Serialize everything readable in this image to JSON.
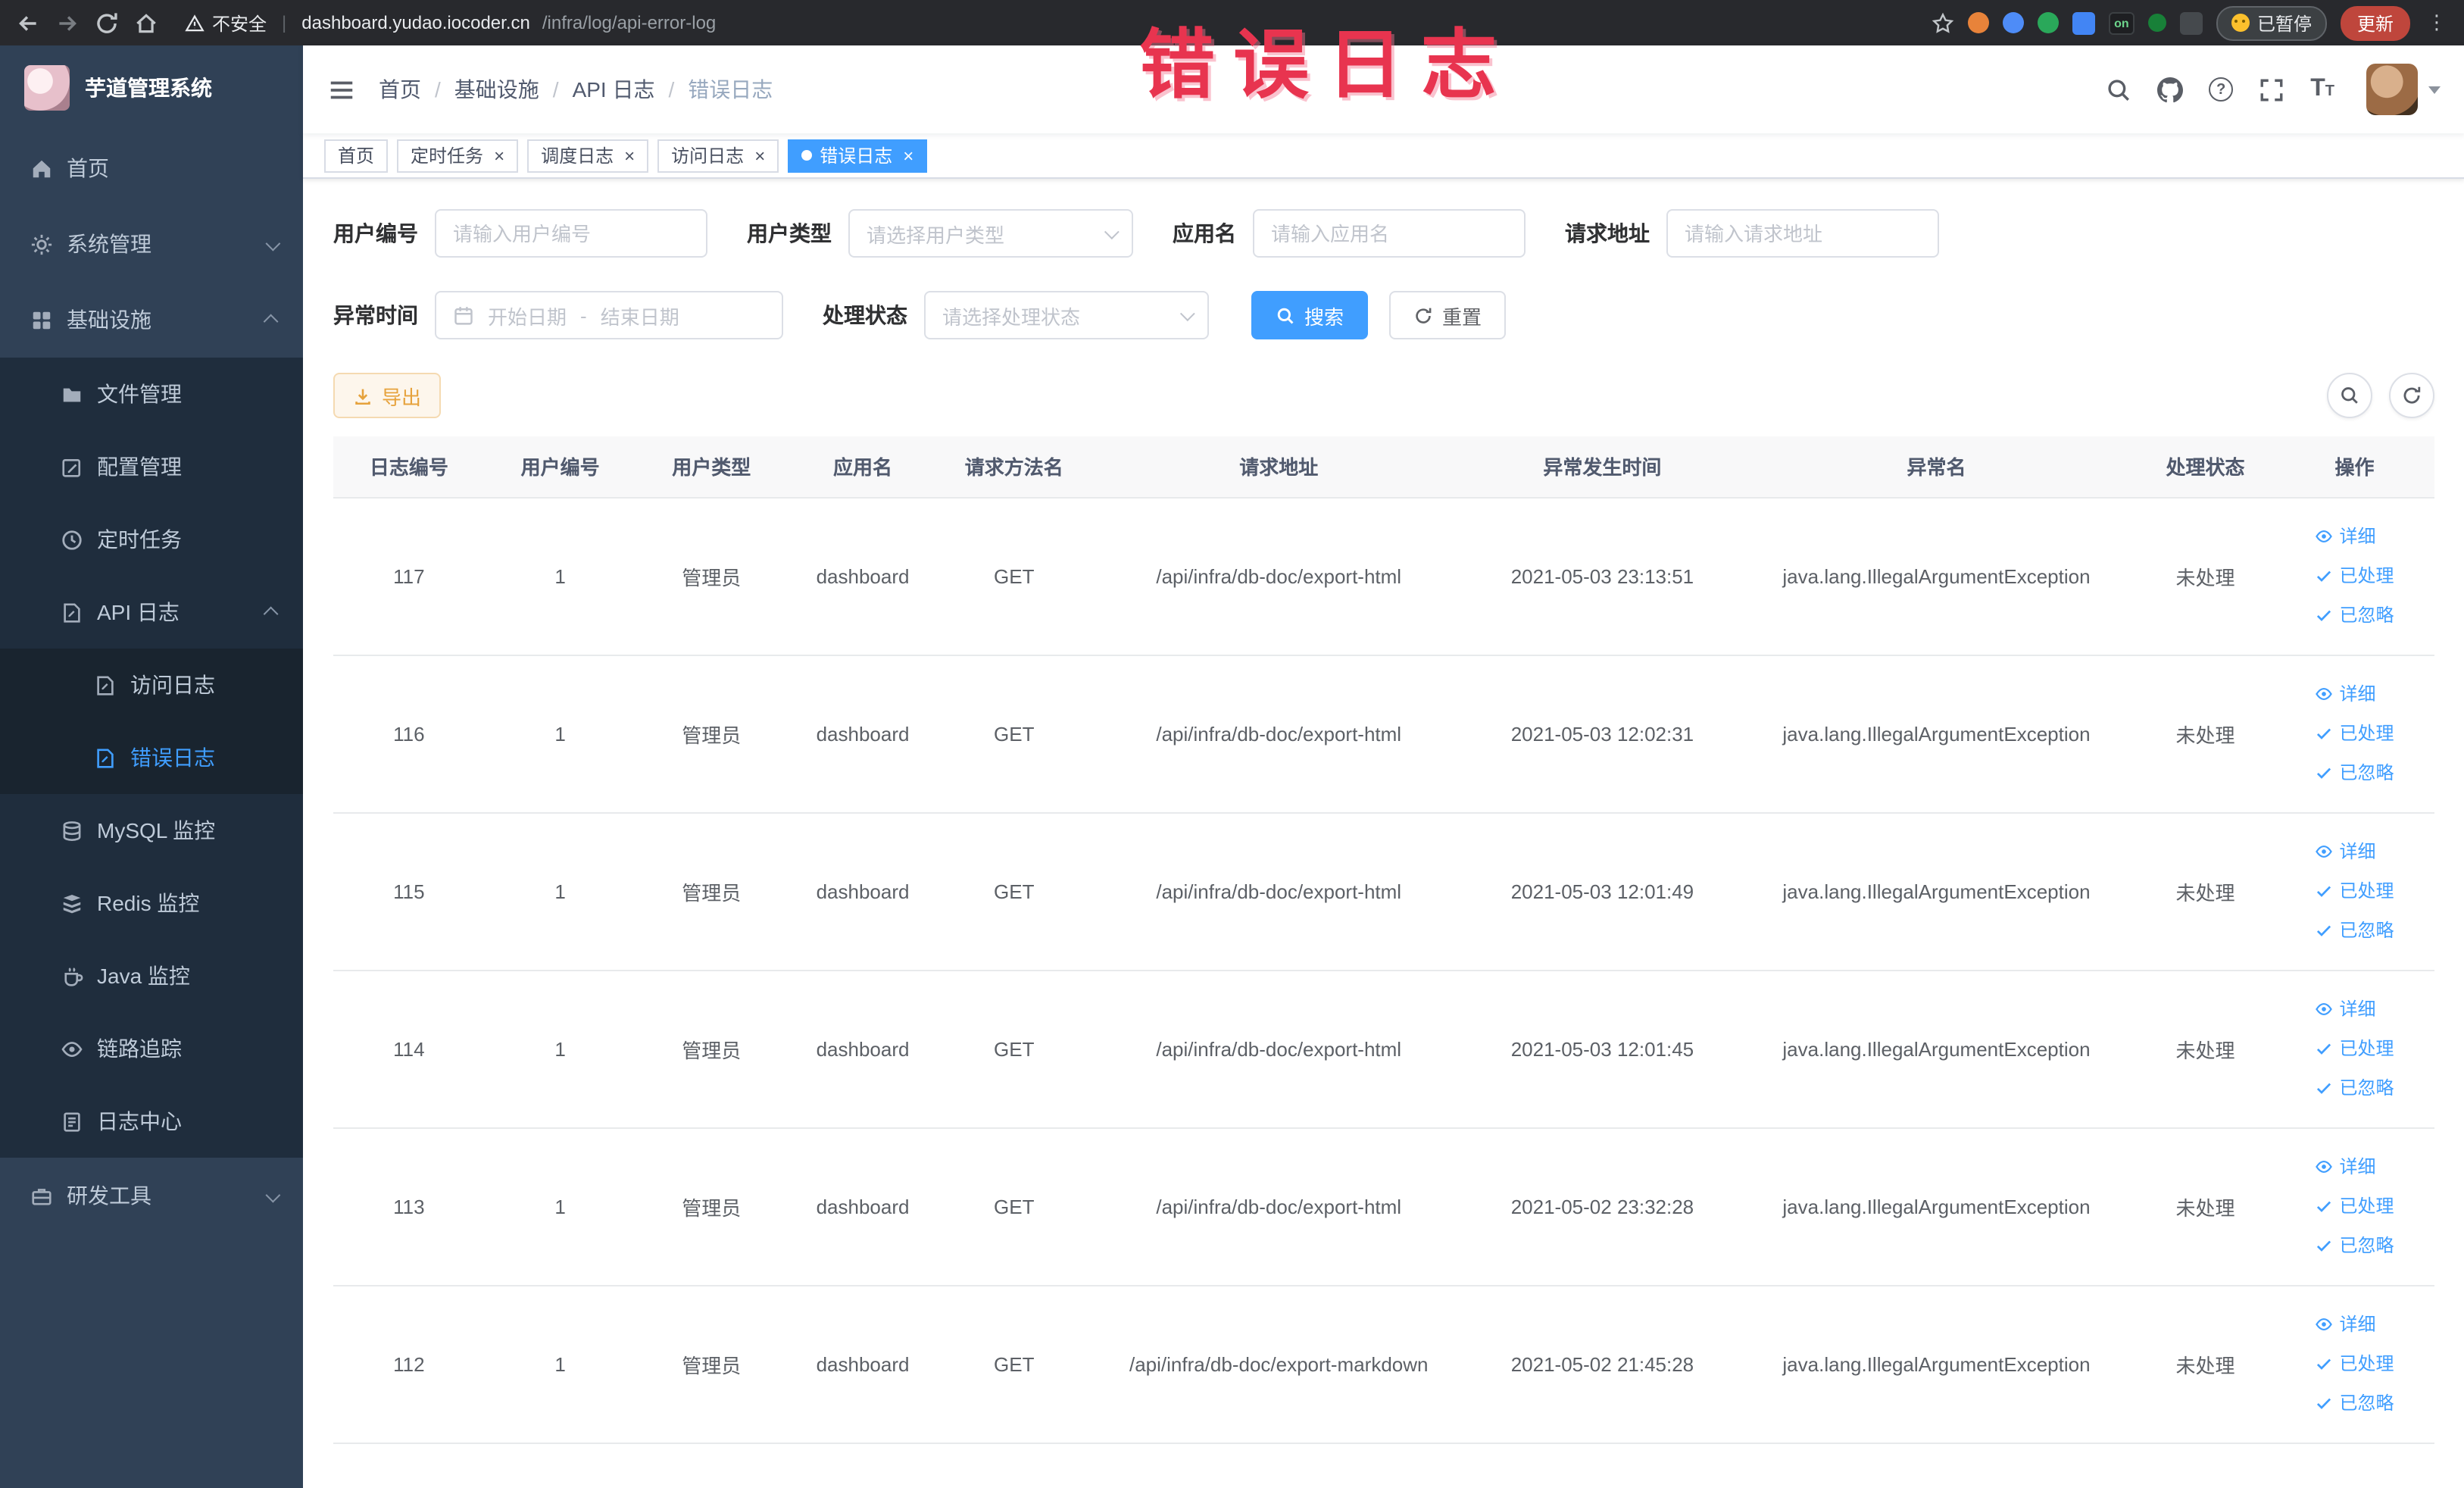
{
  "browser": {
    "security_label": "不安全",
    "url_host": "dashboard.yudao.iocoder.cn",
    "url_path": "/infra/log/api-error-log",
    "extension_badge": "on",
    "paused_label": "已暂停",
    "update_label": "更新"
  },
  "annotation": {
    "text": "错误日志"
  },
  "sidebar": {
    "logo_title": "芋道管理系统",
    "items": [
      {
        "id": "home",
        "label": "首页",
        "icon": "home-icon",
        "level": 1
      },
      {
        "id": "system",
        "label": "系统管理",
        "icon": "gear-icon",
        "level": 1,
        "arrow": "down"
      },
      {
        "id": "infra",
        "label": "基础设施",
        "icon": "grid-icon",
        "level": 1,
        "arrow": "up"
      },
      {
        "id": "file",
        "label": "文件管理",
        "icon": "folder-icon",
        "level": 2
      },
      {
        "id": "config",
        "label": "配置管理",
        "icon": "edit-square-icon",
        "level": 2
      },
      {
        "id": "job",
        "label": "定时任务",
        "icon": "clock-icon",
        "level": 2
      },
      {
        "id": "api-log",
        "label": "API 日志",
        "icon": "doc-edit-icon",
        "level": 2,
        "arrow": "up"
      },
      {
        "id": "access-log",
        "label": "访问日志",
        "icon": "doc-edit-icon",
        "level": 3
      },
      {
        "id": "error-log",
        "label": "错误日志",
        "icon": "doc-edit-icon",
        "level": 3,
        "active": true
      },
      {
        "id": "mysql",
        "label": "MySQL 监控",
        "icon": "database-icon",
        "level": 2
      },
      {
        "id": "redis",
        "label": "Redis 监控",
        "icon": "layers-icon",
        "level": 2
      },
      {
        "id": "java",
        "label": "Java 监控",
        "icon": "coffee-icon",
        "level": 2
      },
      {
        "id": "trace",
        "label": "链路追踪",
        "icon": "eye-icon",
        "level": 2
      },
      {
        "id": "log-center",
        "label": "日志中心",
        "icon": "doc-lines-icon",
        "level": 2
      },
      {
        "id": "dev-tools",
        "label": "研发工具",
        "icon": "briefcase-icon",
        "level": 1,
        "arrow": "down"
      }
    ]
  },
  "breadcrumb": {
    "items": [
      "首页",
      "基础设施",
      "API 日志",
      "错误日志"
    ]
  },
  "tabs": [
    {
      "id": "home",
      "label": "首页",
      "closable": false,
      "active": false
    },
    {
      "id": "job",
      "label": "定时任务",
      "closable": true,
      "active": false
    },
    {
      "id": "job-log",
      "label": "调度日志",
      "closable": true,
      "active": false
    },
    {
      "id": "access-log",
      "label": "访问日志",
      "closable": true,
      "active": false
    },
    {
      "id": "error-log",
      "label": "错误日志",
      "closable": true,
      "active": true
    }
  ],
  "filters": {
    "user_id": {
      "label": "用户编号",
      "placeholder": "请输入用户编号"
    },
    "user_type": {
      "label": "用户类型",
      "placeholder": "请选择用户类型"
    },
    "app_name": {
      "label": "应用名",
      "placeholder": "请输入应用名"
    },
    "request_url": {
      "label": "请求地址",
      "placeholder": "请输入请求地址"
    },
    "exception_time": {
      "label": "异常时间",
      "start_placeholder": "开始日期",
      "separator": "-",
      "end_placeholder": "结束日期"
    },
    "process_status": {
      "label": "处理状态",
      "placeholder": "请选择处理状态"
    },
    "search_label": "搜索",
    "reset_label": "重置"
  },
  "toolbar": {
    "export_label": "导出"
  },
  "table": {
    "columns": [
      "日志编号",
      "用户编号",
      "用户类型",
      "应用名",
      "请求方法名",
      "请求地址",
      "异常发生时间",
      "异常名",
      "处理状态",
      "操作"
    ],
    "actions": {
      "detail": "详细",
      "processed": "已处理",
      "ignored": "已忽略"
    },
    "rows": [
      {
        "log_id": "117",
        "user_id": "1",
        "user_type": "管理员",
        "app_name": "dashboard",
        "method": "GET",
        "url": "/api/infra/db-doc/export-html",
        "time": "2021-05-03 23:13:51",
        "exception": "java.lang.IllegalArgumentException",
        "status": "未处理"
      },
      {
        "log_id": "116",
        "user_id": "1",
        "user_type": "管理员",
        "app_name": "dashboard",
        "method": "GET",
        "url": "/api/infra/db-doc/export-html",
        "time": "2021-05-03 12:02:31",
        "exception": "java.lang.IllegalArgumentException",
        "status": "未处理"
      },
      {
        "log_id": "115",
        "user_id": "1",
        "user_type": "管理员",
        "app_name": "dashboard",
        "method": "GET",
        "url": "/api/infra/db-doc/export-html",
        "time": "2021-05-03 12:01:49",
        "exception": "java.lang.IllegalArgumentException",
        "status": "未处理"
      },
      {
        "log_id": "114",
        "user_id": "1",
        "user_type": "管理员",
        "app_name": "dashboard",
        "method": "GET",
        "url": "/api/infra/db-doc/export-html",
        "time": "2021-05-03 12:01:45",
        "exception": "java.lang.IllegalArgumentException",
        "status": "未处理"
      },
      {
        "log_id": "113",
        "user_id": "1",
        "user_type": "管理员",
        "app_name": "dashboard",
        "method": "GET",
        "url": "/api/infra/db-doc/export-html",
        "time": "2021-05-02 23:32:28",
        "exception": "java.lang.IllegalArgumentException",
        "status": "未处理"
      },
      {
        "log_id": "112",
        "user_id": "1",
        "user_type": "管理员",
        "app_name": "dashboard",
        "method": "GET",
        "url": "/api/infra/db-doc/export-markdown",
        "time": "2021-05-02 21:45:28",
        "exception": "java.lang.IllegalArgumentException",
        "status": "未处理"
      }
    ]
  },
  "colors": {
    "primary": "#409eff",
    "sidebar_bg": "#304156",
    "submenu_bg": "#1f2d3d",
    "warning": "#e6a23c",
    "annotation_red": "#e8344f"
  }
}
